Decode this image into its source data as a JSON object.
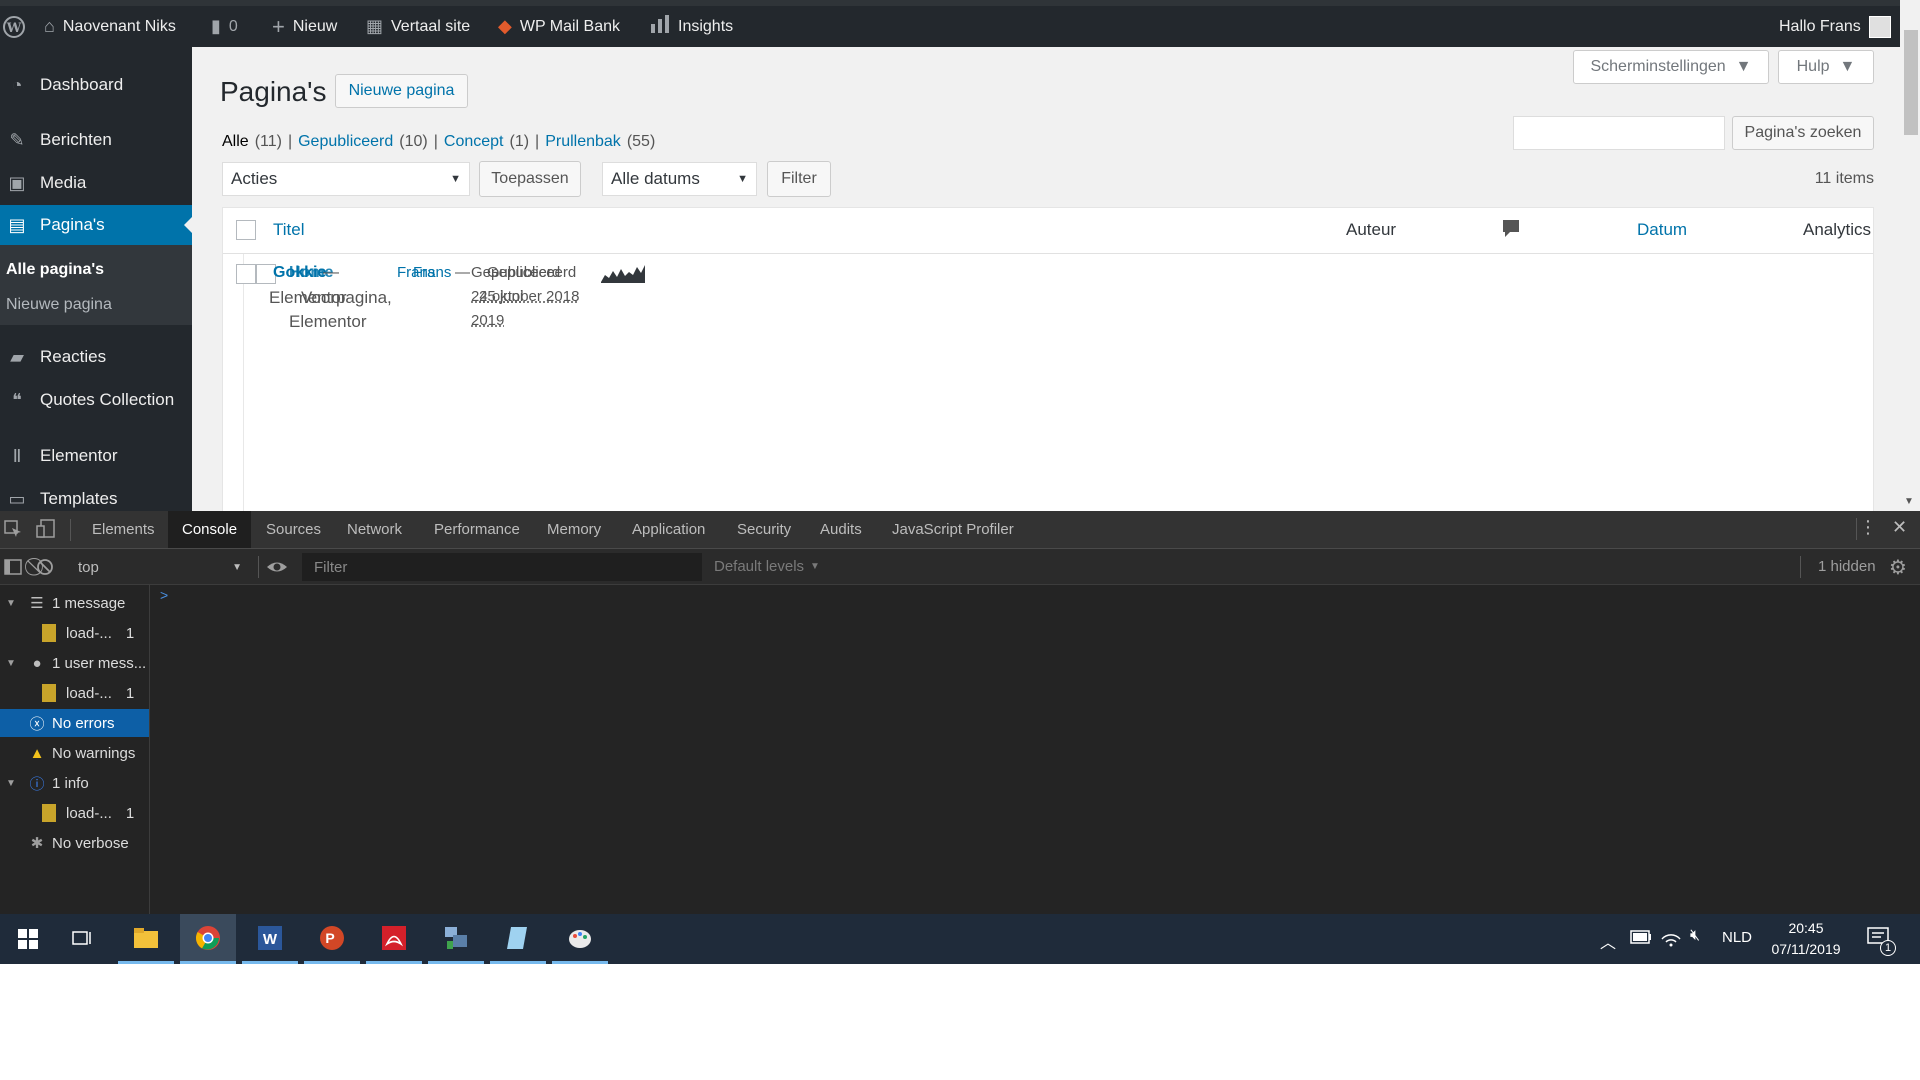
{
  "admin_bar": {
    "site_name": "Naovenant Niks",
    "comments_count": "0",
    "new_label": "Nieuw",
    "translate_label": "Vertaal site",
    "mailbank_label": "WP Mail Bank",
    "insights_label": "Insights",
    "greeting": "Hallo Frans"
  },
  "sidebar": {
    "items": [
      {
        "label": "Dashboard",
        "icon": "dashboard-icon"
      },
      {
        "label": "Berichten",
        "icon": "pin-icon"
      },
      {
        "label": "Media",
        "icon": "media-icon"
      },
      {
        "label": "Pagina's",
        "icon": "pages-icon"
      },
      {
        "label": "Reacties",
        "icon": "comment-icon"
      },
      {
        "label": "Quotes Collection",
        "icon": "quotes-icon"
      },
      {
        "label": "Elementor",
        "icon": "elementor-icon"
      },
      {
        "label": "Templates",
        "icon": "folder-icon"
      }
    ],
    "submenu": [
      "Alle pagina's",
      "Nieuwe pagina"
    ]
  },
  "page": {
    "title": "Pagina's",
    "add_new": "Nieuwe pagina",
    "screen_options": "Scherminstellingen",
    "help": "Hulp",
    "search_button": "Pagina's zoeken",
    "filters": {
      "all": "Alle",
      "all_count": "(11)",
      "published": "Gepubliceerd",
      "published_count": "(10)",
      "draft": "Concept",
      "draft_count": "(1)",
      "trash": "Prullenbak",
      "trash_count": "(55)",
      "sep": "|"
    },
    "bulk_action": "Acties",
    "apply": "Toepassen",
    "dates": "Alle datums",
    "filter": "Filter",
    "items_count": "11 items"
  },
  "table": {
    "columns": {
      "title": "Titel",
      "author": "Auteur",
      "date": "Datum",
      "analytics": "Analytics"
    },
    "overlap": {
      "title_a": "Gokkie",
      "title_b": "Home",
      "dash": "—",
      "title_line2_a": "Elementor",
      "title_line2_b": "Voorpagina,",
      "title_line3": "Elementor",
      "author_a": "Frans",
      "author_b": "Frans",
      "status_a": "Gepubliceerd",
      "status_b": "Gepubliceerd",
      "date_a": "24 oktober 2018",
      "date_b": "25 juni",
      "date_c": "2019"
    }
  },
  "devtools": {
    "tabs": [
      "Elements",
      "Console",
      "Sources",
      "Network",
      "Performance",
      "Memory",
      "Application",
      "Security",
      "Audits",
      "JavaScript Profiler"
    ],
    "active_tab": "Console",
    "context": "top",
    "filter_placeholder": "Filter",
    "levels": "Default levels",
    "hidden": "1 hidden",
    "prompt": ">",
    "sidebar": {
      "messages": "1 message",
      "messages_child": "load-...",
      "messages_child_count": "1",
      "user_messages": "1 user mess...",
      "user_child": "load-...",
      "user_child_count": "1",
      "errors": "No errors",
      "warnings": "No warnings",
      "info": "1 info",
      "info_child": "load-...",
      "info_child_count": "1",
      "verbose": "No verbose"
    }
  },
  "taskbar": {
    "language": "NLD",
    "time": "20:45",
    "date": "07/11/2019",
    "notification_count": "1"
  }
}
